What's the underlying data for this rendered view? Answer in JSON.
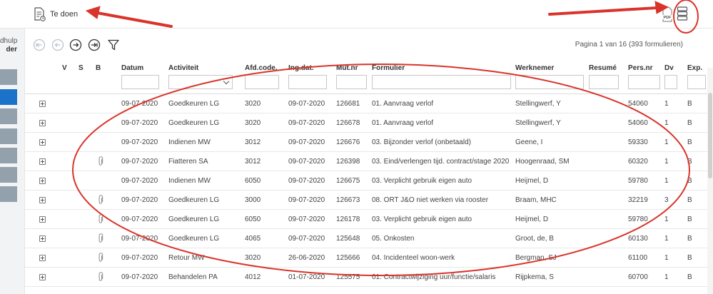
{
  "header": {
    "todo_label": "Te doen",
    "pdf_icon": "pdf-icon",
    "list_icon": "list-view-icon"
  },
  "leftnav": {
    "text_line1": "dhulp",
    "text_line2": "der"
  },
  "toolbar": {
    "icons": [
      "first-page-icon",
      "previous-page-icon",
      "next-page-icon",
      "last-page-icon",
      "filter-icon"
    ],
    "paging_text": "Pagina 1 van 16 (393 formulieren)"
  },
  "table": {
    "columns": [
      "V",
      "S",
      "B",
      "Datum",
      "Activiteit",
      "Afd.code.",
      "Ing.dat.",
      "Mut.nr",
      "Formulier",
      "Werknemer",
      "Resumé",
      "Pers.nr",
      "Dv",
      "Exp."
    ],
    "rows": [
      {
        "attachment": false,
        "datum": "09-07-2020",
        "activiteit": "Goedkeuren LG",
        "afd": "3020",
        "ing": "09-07-2020",
        "mut": "126681",
        "formulier": "01. Aanvraag verlof",
        "werknemer": "Stellingwerf, Y",
        "pers": "54060",
        "dv": "1",
        "exp": "B"
      },
      {
        "attachment": false,
        "datum": "09-07-2020",
        "activiteit": "Goedkeuren LG",
        "afd": "3020",
        "ing": "09-07-2020",
        "mut": "126678",
        "formulier": "01. Aanvraag verlof",
        "werknemer": "Stellingwerf, Y",
        "pers": "54060",
        "dv": "1",
        "exp": "B"
      },
      {
        "attachment": false,
        "datum": "09-07-2020",
        "activiteit": "Indienen MW",
        "afd": "3012",
        "ing": "09-07-2020",
        "mut": "126676",
        "formulier": "03. Bijzonder verlof (onbetaald)",
        "werknemer": "Geene, I",
        "pers": "59330",
        "dv": "1",
        "exp": "B"
      },
      {
        "attachment": true,
        "datum": "09-07-2020",
        "activiteit": "Fiatteren SA",
        "afd": "3012",
        "ing": "09-07-2020",
        "mut": "126398",
        "formulier": "03. Eind/verlengen tijd. contract/stage 2020",
        "werknemer": "Hoogenraad, SM",
        "pers": "60320",
        "dv": "1",
        "exp": "B"
      },
      {
        "attachment": false,
        "datum": "09-07-2020",
        "activiteit": "Indienen MW",
        "afd": "6050",
        "ing": "09-07-2020",
        "mut": "126675",
        "formulier": "03. Verplicht gebruik eigen auto",
        "werknemer": "Heijmel, D",
        "pers": "59780",
        "dv": "1",
        "exp": "B"
      },
      {
        "attachment": true,
        "datum": "09-07-2020",
        "activiteit": "Goedkeuren LG",
        "afd": "3000",
        "ing": "09-07-2020",
        "mut": "126673",
        "formulier": "08. ORT J&O niet werken via rooster",
        "werknemer": "Braam, MHC",
        "pers": "32219",
        "dv": "3",
        "exp": "B"
      },
      {
        "attachment": true,
        "datum": "09-07-2020",
        "activiteit": "Goedkeuren LG",
        "afd": "6050",
        "ing": "09-07-2020",
        "mut": "126178",
        "formulier": "03. Verplicht gebruik eigen auto",
        "werknemer": "Heijmel, D",
        "pers": "59780",
        "dv": "1",
        "exp": "B"
      },
      {
        "attachment": true,
        "datum": "09-07-2020",
        "activiteit": "Goedkeuren LG",
        "afd": "4065",
        "ing": "09-07-2020",
        "mut": "125648",
        "formulier": "05. Onkosten",
        "werknemer": "Groot, de, B",
        "pers": "60130",
        "dv": "1",
        "exp": "B"
      },
      {
        "attachment": true,
        "datum": "09-07-2020",
        "activiteit": "Retour MW",
        "afd": "3020",
        "ing": "26-06-2020",
        "mut": "125666",
        "formulier": "04. Incidenteel woon-werk",
        "werknemer": "Bergman, SJ",
        "pers": "61100",
        "dv": "1",
        "exp": "B"
      },
      {
        "attachment": true,
        "datum": "09-07-2020",
        "activiteit": "Behandelen PA",
        "afd": "4012",
        "ing": "01-07-2020",
        "mut": "125575",
        "formulier": "01. Contractwijziging uur/functie/salaris",
        "werknemer": "Rijpkema, S",
        "pers": "60700",
        "dv": "1",
        "exp": "B"
      }
    ]
  },
  "colors": {
    "annotation_red": "#d9342b",
    "active_nav": "#1a73c8",
    "nav_block": "#93a1ad"
  }
}
